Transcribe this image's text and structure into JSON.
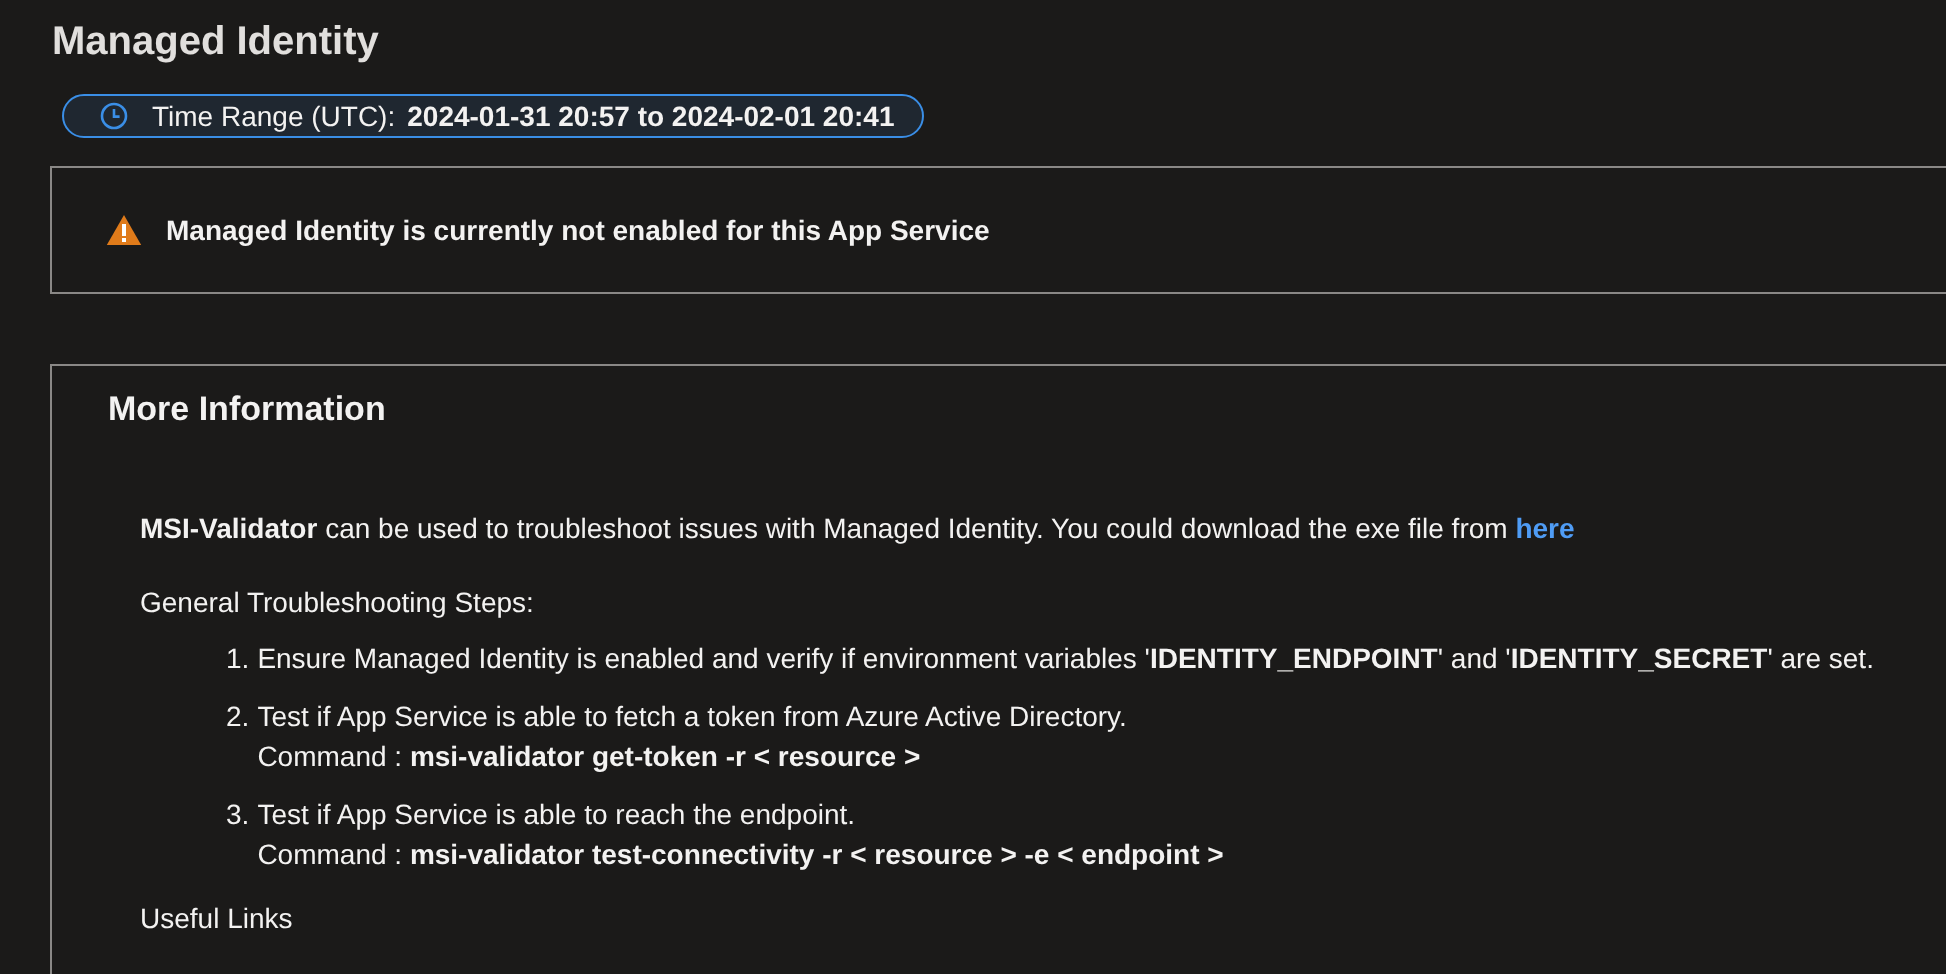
{
  "title": "Managed Identity",
  "time_range": {
    "label": "Time Range (UTC):",
    "value": "2024-01-31 20:57 to 2024-02-01 20:41"
  },
  "alert": {
    "kind": "warning",
    "message": "Managed Identity is currently not enabled for this App Service"
  },
  "more_information": {
    "heading": "More Information",
    "intro": "**MSI-Validator** can be used to troubleshoot issues with Managed Identity. You could download the exe file from",
    "intro_link": "here",
    "steps_heading": "General Troubleshooting Steps:",
    "steps": [
      {
        "number": "1.",
        "text": "Ensure Managed Identity is enabled and verify if environment variables '**IDENTITY_ENDPOINT**' and '**IDENTITY_SECRET**' are set."
      },
      {
        "number": "2.",
        "text": "Test if App Service is able to fetch a token from Azure Active Directory.",
        "command_label": "Command :",
        "command": "msi-validator get-token -r < resource >"
      },
      {
        "number": "3.",
        "text": "Test if App Service is able to reach the endpoint.",
        "command_label": "Command :",
        "command": "msi-validator test-connectivity -r < resource > -e < endpoint >"
      }
    ],
    "links_heading": "Useful Links"
  }
}
